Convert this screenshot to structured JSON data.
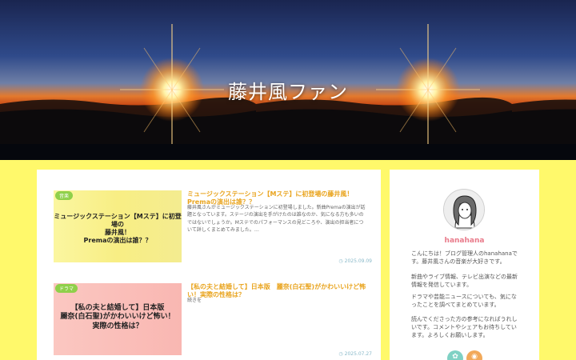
{
  "site": {
    "title": "藤井風ファン"
  },
  "posts": [
    {
      "category": "音楽",
      "thumb_text": "ミュージックステーション【Mステ】に初登場の\n藤井風！\nPremaの演出は誰？？",
      "title": "ミュージックステーション【Mステ】に初登場の藤井風！Premaの演出は誰？？",
      "excerpt": "藤井風さんがミュージックステーションに初登場しました。新曲Premaの演出が話題となっています。ステージの演出を手がけたのは誰なのか、気になる方も多いのではないでしょうか。Mステでのパフォーマンスの見どころや、演出の担当者について詳しくまとめてみました。…",
      "date": "2025.09.09"
    },
    {
      "category": "ドラマ",
      "thumb_text": "【私の夫と結婚して】日本版\n麗奈(白石聖)がかわいいけど怖い！\n実際の性格は？",
      "title": "【私の夫と結婚して】日本版　麗奈(白石聖)がかわいいけど怖い！実際の性格は？",
      "excerpt": "続きを",
      "date": "2025.07.27"
    }
  ],
  "sidebar": {
    "author_name": "hanahana",
    "bio": [
      "こんにちは！ブログ管理人のhanahanaです。藤井風さんの音楽が大好きです。",
      "新曲やライブ情報、テレビ出演などの最新情報を発信しています。",
      "ドラマや芸能ニュースについても、気になったことを調べてまとめています。",
      "読んでくださった方の参考になればうれしいです。コメントやシェアもお待ちしています。よろしくお願いします。"
    ]
  },
  "icons": {
    "date": "clock-icon",
    "social_1": "feedly-icon",
    "social_2": "rss-icon"
  },
  "colors": {
    "background": "#fff96b",
    "accent_title": "#e9a41e",
    "author_name": "#e97a8a",
    "category_badge": "#8fd04a"
  }
}
